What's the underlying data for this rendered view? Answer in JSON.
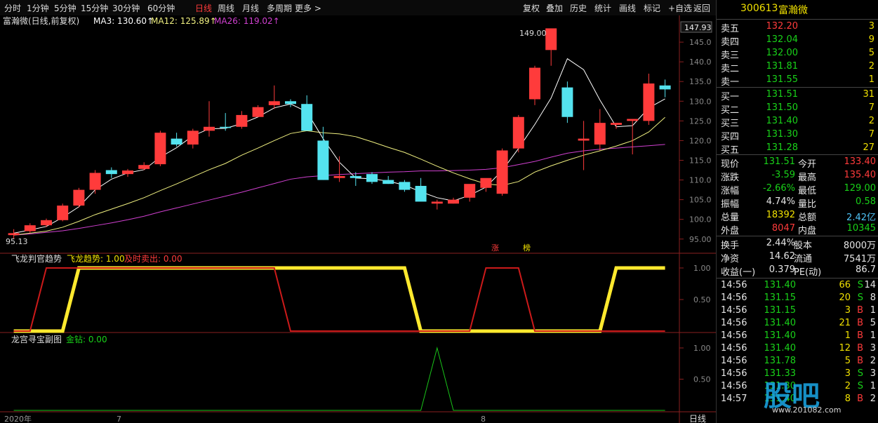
{
  "toolbar": {
    "periods": [
      "分时",
      "1分钟",
      "5分钟",
      "15分钟",
      "30分钟",
      "60分钟",
      "日线",
      "周线",
      "月线",
      "多周期",
      "更多 >"
    ],
    "active": "日线",
    "actions": [
      "复权",
      "叠加",
      "历史",
      "统计",
      "画线",
      "标记",
      "+自选",
      "返回"
    ]
  },
  "main_legend": {
    "name": "富瀚微(日线,前复权)",
    "ma3": "MA3: 130.60↑",
    "ma12": "MA12: 125.89↑",
    "ma26": "MA26: 119.02↑"
  },
  "price_labels": {
    "high": "149.00",
    "low": "95.13",
    "current_box": "147.93",
    "markers": [
      "涨",
      "榜"
    ]
  },
  "sub1_legend": {
    "name": "飞龙判官趋势",
    "trend": "飞龙趋势: 1.00",
    "sell": "及时卖出: 0.00"
  },
  "sub2_legend": {
    "name": "龙宫寻宝副图",
    "gold": "金钻: 0.00"
  },
  "bottom": {
    "year": "2020年",
    "m7": "7",
    "m8": "8",
    "period": "日线"
  },
  "colors": {
    "up": "#ff3b3b",
    "down": "#54e3ef",
    "ma3": "#ffffff",
    "ma12": "#f0f080",
    "ma26": "#d040d0",
    "bg": "#000000"
  },
  "chart_data": [
    {
      "type": "candlestick",
      "ylim": [
        93,
        150
      ],
      "yticks": [
        "145.0",
        "140.0",
        "135.0",
        "130.0",
        "125.0",
        "120.0",
        "115.0",
        "110.0",
        "105.0",
        "100.0",
        "95.00"
      ],
      "candles": [
        [
          96,
          97.5,
          95.13,
          96.5
        ],
        [
          97,
          99,
          96.5,
          98.5
        ],
        [
          98.5,
          100.2,
          98,
          99.8
        ],
        [
          99.8,
          104,
          99.5,
          103.5
        ],
        [
          103.5,
          108,
          103,
          107.5
        ],
        [
          107.5,
          112.5,
          106.5,
          111.8
        ],
        [
          112.5,
          113.2,
          110.5,
          111.5
        ],
        [
          111.5,
          112.8,
          110.8,
          112.4
        ],
        [
          112.8,
          114.5,
          112.5,
          113.8
        ],
        [
          114,
          122.5,
          113.5,
          122
        ],
        [
          120.5,
          122,
          118.5,
          119
        ],
        [
          119,
          123,
          118,
          122.5
        ],
        [
          122.5,
          130,
          121,
          123.5
        ],
        [
          123.5,
          127,
          122.5,
          123.2
        ],
        [
          123.5,
          127.5,
          123,
          126.5
        ],
        [
          126,
          129,
          126,
          128.5
        ],
        [
          129,
          134,
          128,
          130
        ],
        [
          130,
          130.5,
          128.5,
          129.3
        ],
        [
          129.3,
          131.5,
          123,
          122.5
        ],
        [
          120,
          123.5,
          110,
          110
        ],
        [
          110.5,
          116,
          109.5,
          111
        ],
        [
          111,
          112,
          108.5,
          110.5
        ],
        [
          111.5,
          112,
          109,
          109.5
        ],
        [
          110,
          111,
          109,
          109
        ],
        [
          109.5,
          110,
          107,
          107.5
        ],
        [
          108.5,
          110.5,
          105.5,
          104.5
        ],
        [
          104,
          105,
          102.5,
          104.5
        ],
        [
          104,
          105.5,
          104,
          105
        ],
        [
          105.5,
          107.5,
          104.5,
          109
        ],
        [
          108,
          110,
          107,
          110.5
        ],
        [
          106.5,
          118,
          106,
          117.5
        ],
        [
          118,
          126.5,
          117,
          126
        ],
        [
          130.5,
          139,
          129,
          138.5
        ],
        [
          143,
          147,
          139,
          148.5
        ],
        [
          133.5,
          135,
          124.5,
          126
        ],
        [
          120,
          125,
          112.5,
          120.5
        ],
        [
          119,
          128,
          117.5,
          124.5
        ],
        [
          124,
          124.2,
          123,
          124.5
        ],
        [
          125,
          125.5,
          116.5,
          125.5
        ],
        [
          125,
          137,
          124,
          134.5
        ],
        [
          134,
          135.5,
          131,
          133
        ]
      ],
      "ma3": [
        96.5,
        97.3,
        98.2,
        100.5,
        103.2,
        107.5,
        110.2,
        111.8,
        112.6,
        115.8,
        118.2,
        121.2,
        123,
        123.1,
        124.3,
        126,
        128.3,
        129.3,
        127.3,
        120.5,
        114.5,
        110.5,
        110.3,
        109.7,
        108.7,
        107,
        105.5,
        104.7,
        106.1,
        108.2,
        112.4,
        118,
        124.1,
        130.8,
        140.8,
        138,
        130.3,
        123.5,
        123.8,
        128.3,
        130.6
      ],
      "ma12": [
        96,
        96.5,
        97,
        98,
        99.5,
        101.2,
        102.6,
        104,
        105.5,
        107.3,
        109,
        110.8,
        112.6,
        114.2,
        116.3,
        118.1,
        120,
        121.8,
        122.5,
        122,
        121.7,
        121,
        119.7,
        118.3,
        117,
        115.3,
        113.5,
        111.8,
        110.3,
        109,
        108.6,
        109.6,
        112,
        113.6,
        115,
        116.3,
        117.4,
        118.6,
        120,
        122.2,
        125.9
      ],
      "ma26": [
        96,
        96.3,
        96.7,
        97.1,
        97.7,
        98.4,
        99.1,
        99.9,
        100.8,
        101.9,
        102.9,
        103.9,
        104.9,
        105.9,
        106.9,
        108,
        109.1,
        110.2,
        110.8,
        111.1,
        111.4,
        111.6,
        111.8,
        112,
        112.1,
        112.3,
        112.3,
        112.4,
        112.5,
        112.7,
        113.1,
        113.9,
        114.7,
        115.8,
        116.8,
        117.4,
        117.8,
        118.1,
        118.4,
        118.7,
        119.02
      ]
    },
    {
      "type": "line",
      "title": "飞龙判官趋势",
      "ylim": [
        0,
        1
      ],
      "yticks": [
        "1.00",
        "0.50"
      ],
      "series": [
        {
          "name": "飞龙趋势",
          "values": [
            0,
            0,
            0,
            0,
            1,
            1,
            1,
            1,
            1,
            1,
            1,
            1,
            1,
            1,
            1,
            1,
            1,
            1,
            1,
            1,
            1,
            1,
            1,
            1,
            1,
            0,
            0,
            0,
            0,
            0,
            0,
            0,
            0,
            0,
            0,
            0,
            0,
            1,
            1,
            1,
            1
          ]
        },
        {
          "name": "及时卖出",
          "values": [
            0,
            0,
            1,
            1,
            1,
            1,
            1,
            1,
            1,
            1,
            1,
            1,
            1,
            1,
            1,
            1,
            1,
            0,
            0,
            0,
            0,
            0,
            0,
            0,
            0,
            0,
            0,
            0,
            0,
            1,
            1,
            1,
            0,
            0,
            0,
            0,
            0,
            0,
            0,
            0,
            0
          ]
        }
      ]
    },
    {
      "type": "line",
      "title": "龙宫寻宝副图",
      "ylim": [
        0,
        1
      ],
      "yticks": [
        "1.00",
        "0.50"
      ],
      "series": [
        {
          "name": "金钻",
          "values": [
            0,
            0,
            0,
            0,
            0,
            0,
            0,
            0,
            0,
            0,
            0,
            0,
            0,
            0,
            0,
            0,
            0,
            0,
            0,
            0,
            0,
            0,
            0,
            0,
            0,
            0,
            1,
            0,
            0,
            0,
            0,
            0,
            0,
            0,
            0,
            0,
            0,
            0,
            0,
            0,
            0
          ]
        }
      ]
    }
  ],
  "quote": {
    "code": "300613",
    "name": "富瀚微",
    "asks": [
      {
        "label": "卖五",
        "price": "132.20",
        "vol": "3"
      },
      {
        "label": "卖四",
        "price": "132.04",
        "vol": "9"
      },
      {
        "label": "卖三",
        "price": "132.00",
        "vol": "5"
      },
      {
        "label": "卖二",
        "price": "131.81",
        "vol": "2"
      },
      {
        "label": "卖一",
        "price": "131.55",
        "vol": "1"
      }
    ],
    "bids": [
      {
        "label": "买一",
        "price": "131.51",
        "vol": "31"
      },
      {
        "label": "买二",
        "price": "131.50",
        "vol": "7"
      },
      {
        "label": "买三",
        "price": "131.40",
        "vol": "2"
      },
      {
        "label": "买四",
        "price": "131.30",
        "vol": "7"
      },
      {
        "label": "买五",
        "price": "131.28",
        "vol": "27"
      }
    ],
    "stats": [
      [
        {
          "l": "现价",
          "v": "131.51",
          "c": "green"
        },
        {
          "l": "今开",
          "v": "133.40",
          "c": "red"
        }
      ],
      [
        {
          "l": "涨跌",
          "v": "-3.59",
          "c": "green"
        },
        {
          "l": "最高",
          "v": "135.40",
          "c": "red"
        }
      ],
      [
        {
          "l": "涨幅",
          "v": "-2.66%",
          "c": "green"
        },
        {
          "l": "最低",
          "v": "129.00",
          "c": "green"
        }
      ],
      [
        {
          "l": "振幅",
          "v": "4.74%",
          "c": "white"
        },
        {
          "l": "量比",
          "v": "0.58",
          "c": "green"
        }
      ],
      [
        {
          "l": "总量",
          "v": "18392",
          "c": "yellow"
        },
        {
          "l": "总额",
          "v": "2.42亿",
          "c": "cyan"
        }
      ],
      [
        {
          "l": "外盘",
          "v": "8047",
          "c": "red"
        },
        {
          "l": "内盘",
          "v": "10345",
          "c": "green"
        }
      ]
    ],
    "stats2": [
      [
        {
          "l": "换手",
          "v": "2.44%",
          "c": "white"
        },
        {
          "l": "股本",
          "v": "8000万",
          "c": "white"
        }
      ],
      [
        {
          "l": "净资",
          "v": "14.62",
          "c": "white"
        },
        {
          "l": "流通",
          "v": "7541万",
          "c": "white"
        }
      ],
      [
        {
          "l": "收益(一)",
          "v": "0.379",
          "c": "white"
        },
        {
          "l": "PE(动)",
          "v": "86.7",
          "c": "white"
        }
      ]
    ],
    "ticks": [
      {
        "t": "14:56",
        "p": "131.40",
        "pc": "green",
        "v": "66",
        "s": "S",
        "n": "14"
      },
      {
        "t": "14:56",
        "p": "131.15",
        "pc": "green",
        "v": "20",
        "s": "S",
        "n": "8"
      },
      {
        "t": "14:56",
        "p": "131.15",
        "pc": "green",
        "v": "3",
        "s": "B",
        "n": "1"
      },
      {
        "t": "14:56",
        "p": "131.40",
        "pc": "green",
        "v": "21",
        "s": "B",
        "n": "5"
      },
      {
        "t": "14:56",
        "p": "131.40",
        "pc": "green",
        "v": "1",
        "s": "B",
        "n": "1"
      },
      {
        "t": "14:56",
        "p": "131.40",
        "pc": "green",
        "v": "12",
        "s": "B",
        "n": "3"
      },
      {
        "t": "14:56",
        "p": "131.78",
        "pc": "green",
        "v": "5",
        "s": "B",
        "n": "2"
      },
      {
        "t": "14:56",
        "p": "131.33",
        "pc": "green",
        "v": "3",
        "s": "S",
        "n": "3"
      },
      {
        "t": "14:56",
        "p": "131.30",
        "pc": "green",
        "v": "2",
        "s": "S",
        "n": "1"
      },
      {
        "t": "14:57",
        "p": "131.40",
        "pc": "green",
        "v": "8",
        "s": "B",
        "n": "2"
      }
    ]
  },
  "watermark": {
    "big": "股吧",
    "site": "www.201082.com"
  }
}
